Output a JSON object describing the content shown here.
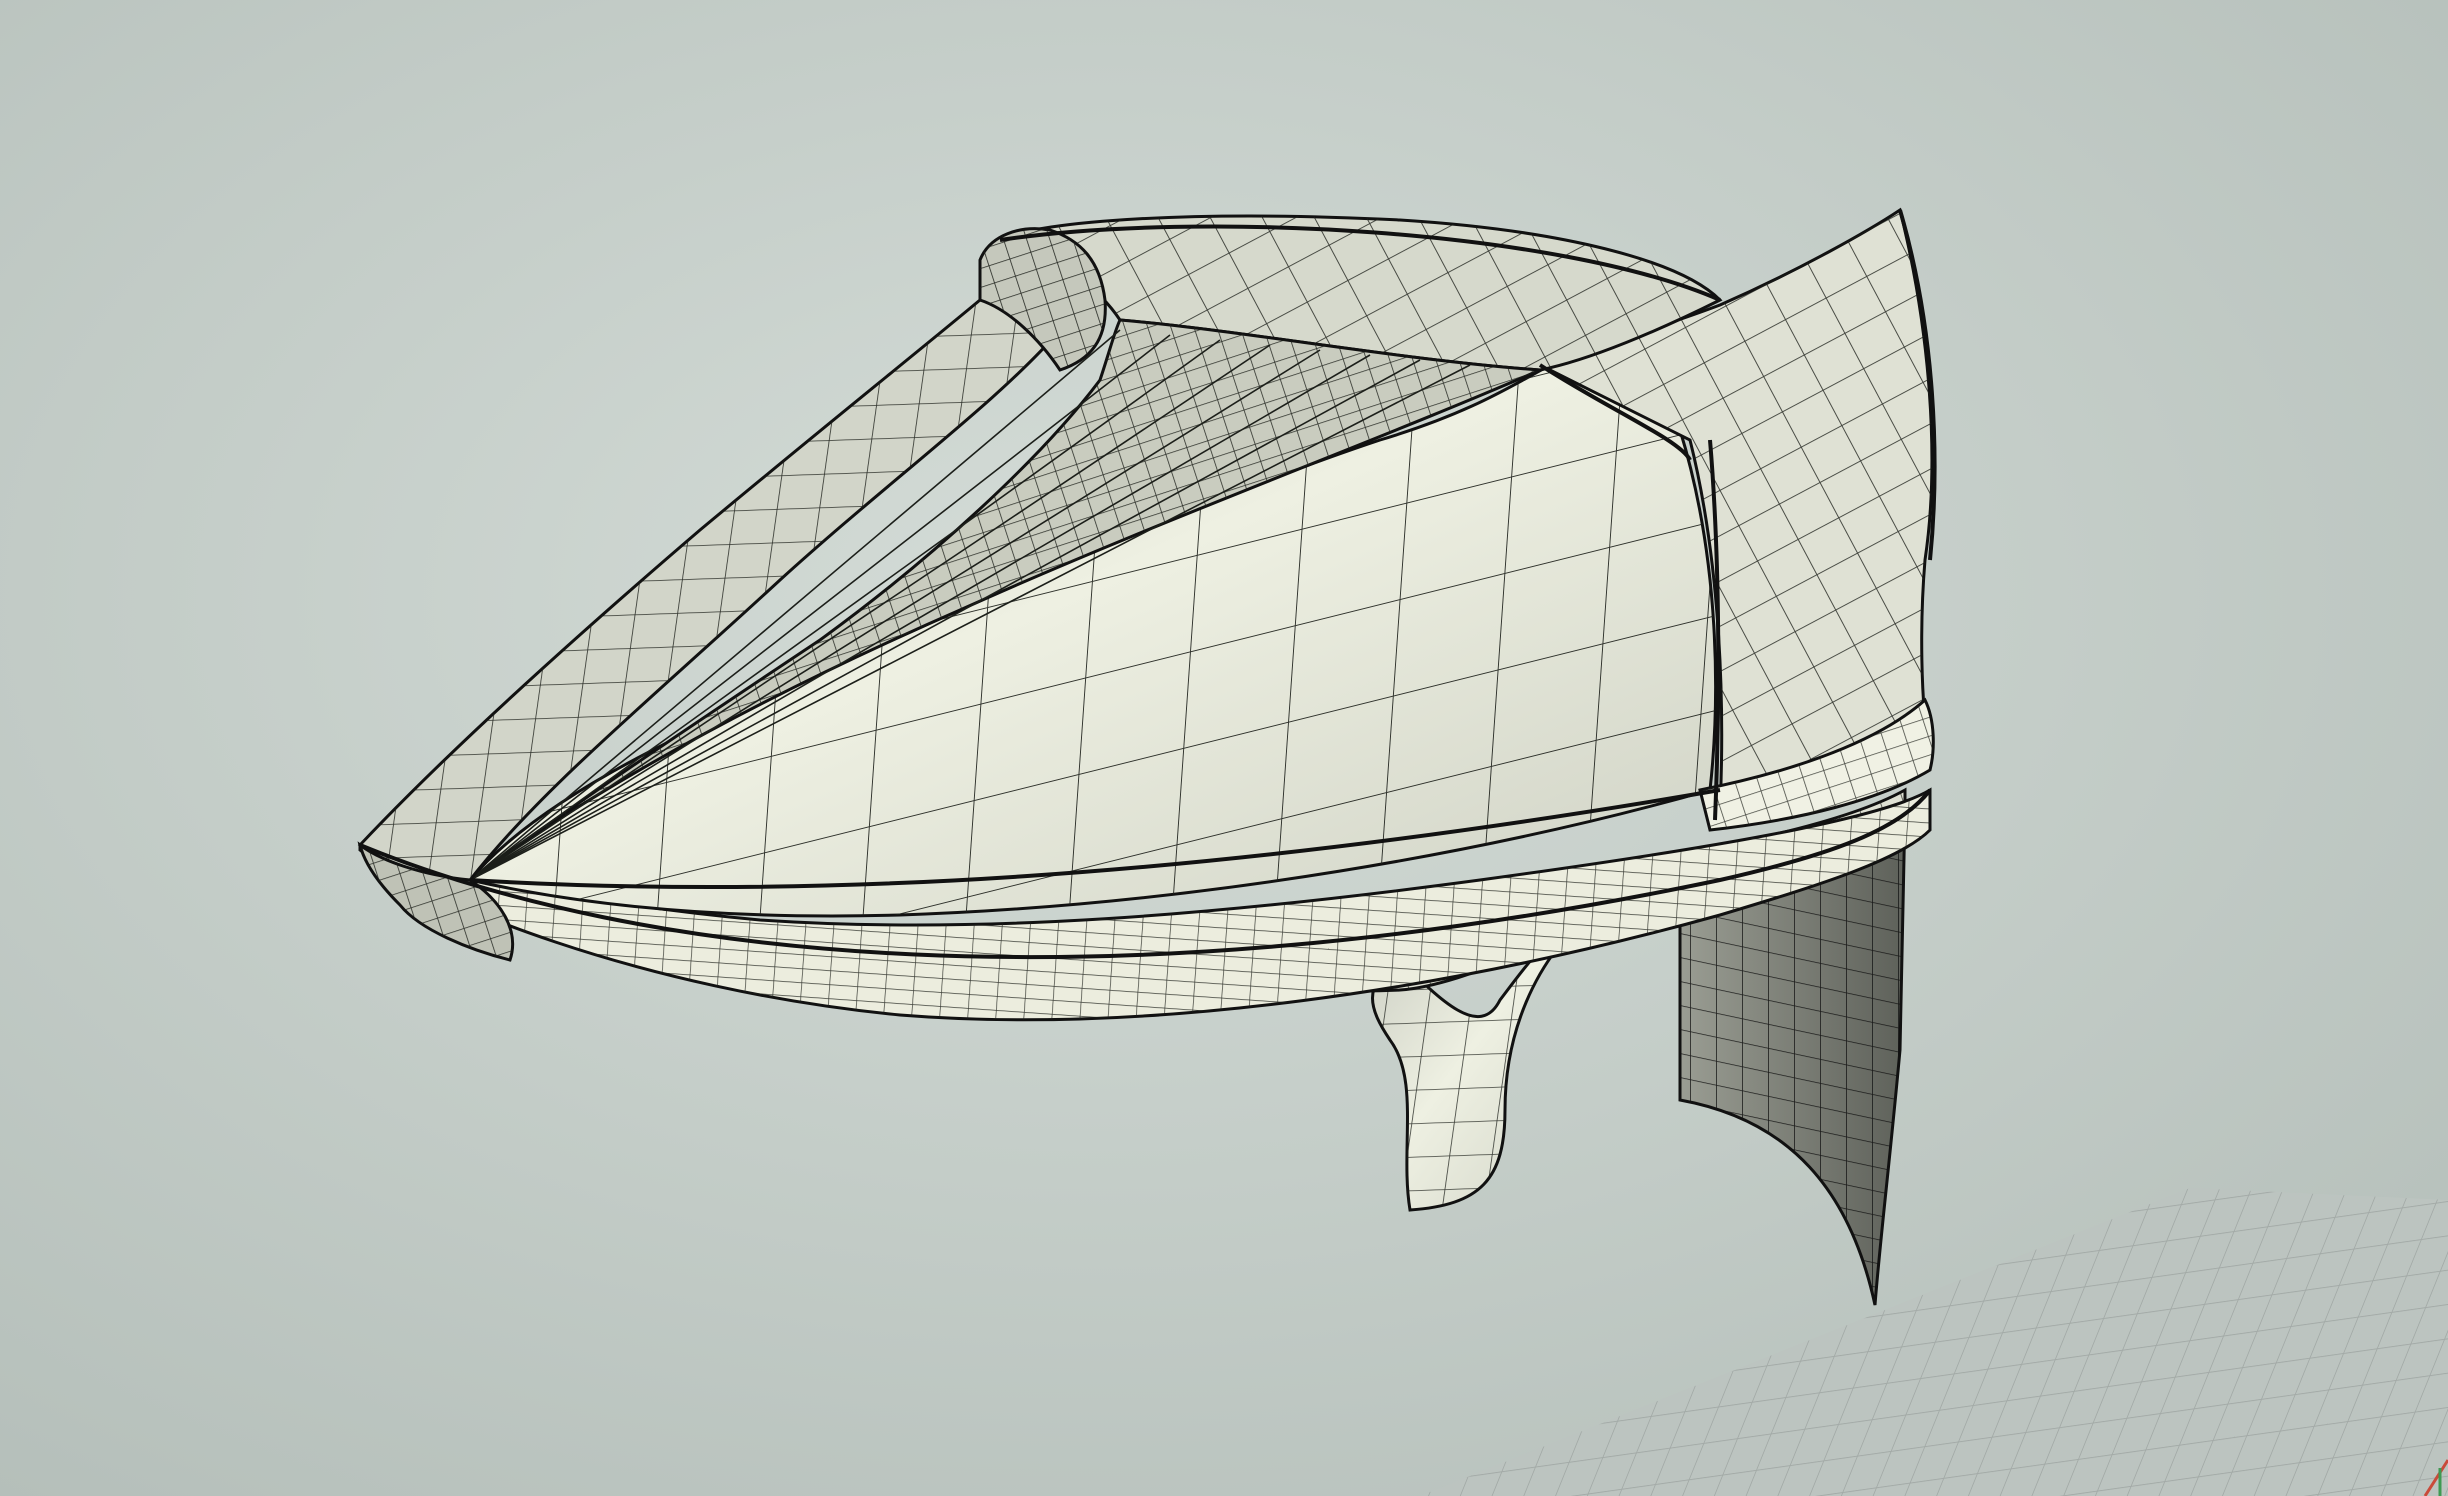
{
  "viewport": {
    "background_color": "#c4cdc8",
    "surface_color": "#e6e8dc",
    "wire_color": "#1c1f1a",
    "grid_color": "#9fa6a3",
    "axis_red_color": "#c94a3a",
    "axis_green_color": "#3f9a52"
  }
}
